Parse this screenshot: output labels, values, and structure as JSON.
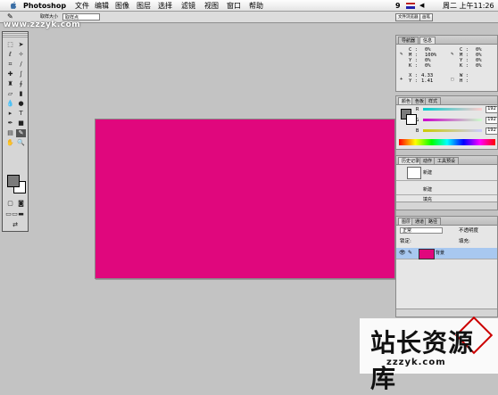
{
  "menubar": {
    "app": "Photoshop",
    "items": [
      "文件",
      "编辑",
      "图像",
      "图层",
      "选择",
      "滤镜",
      "视图",
      "窗口",
      "帮助"
    ],
    "badge": "9",
    "clock": "周二 上午11:26"
  },
  "options": {
    "label1": "取样大小",
    "select1": "取样点",
    "tab1": "文件浏览器",
    "tab2": "画笔"
  },
  "watermark_top": "www.zzzyk.com",
  "info_panel": {
    "tabs": [
      "导航器",
      "信息"
    ],
    "left": [
      "C :",
      "M :",
      "Y :",
      "K :"
    ],
    "leftv": [
      "0%",
      "100%",
      "0%",
      "0%"
    ],
    "right": [
      "C :",
      "M :",
      "Y :",
      "K :"
    ],
    "rightv": [
      "0%",
      "0%",
      "0%",
      "0%"
    ],
    "xy": [
      "X :",
      "Y :"
    ],
    "xyv": [
      "4.33",
      "1.41"
    ],
    "wh": [
      "W :",
      "H :"
    ]
  },
  "color_panel": {
    "tabs": [
      "颜色",
      "色板",
      "样式"
    ],
    "channels": [
      "R",
      "G",
      "B"
    ],
    "values": [
      "192",
      "192",
      "192"
    ]
  },
  "history_panel": {
    "tabs": [
      "历史记录",
      "动作",
      "工具预设"
    ],
    "snapshot": "新建",
    "items": [
      "新建",
      "填充"
    ]
  },
  "layers_panel": {
    "tabs": [
      "图层",
      "通道",
      "路径"
    ],
    "mode": "正常",
    "opacity_label": "不透明度",
    "lock_label": "锁定:",
    "fill_label": "填充:",
    "layer_name": "背景"
  },
  "logo": {
    "cn": "站长资源库",
    "en": "zzzyk.com"
  },
  "colors": {
    "canvas": "#e0077d",
    "workspace": "#c3c3c3",
    "layer_selected": "#a8c8f0"
  }
}
